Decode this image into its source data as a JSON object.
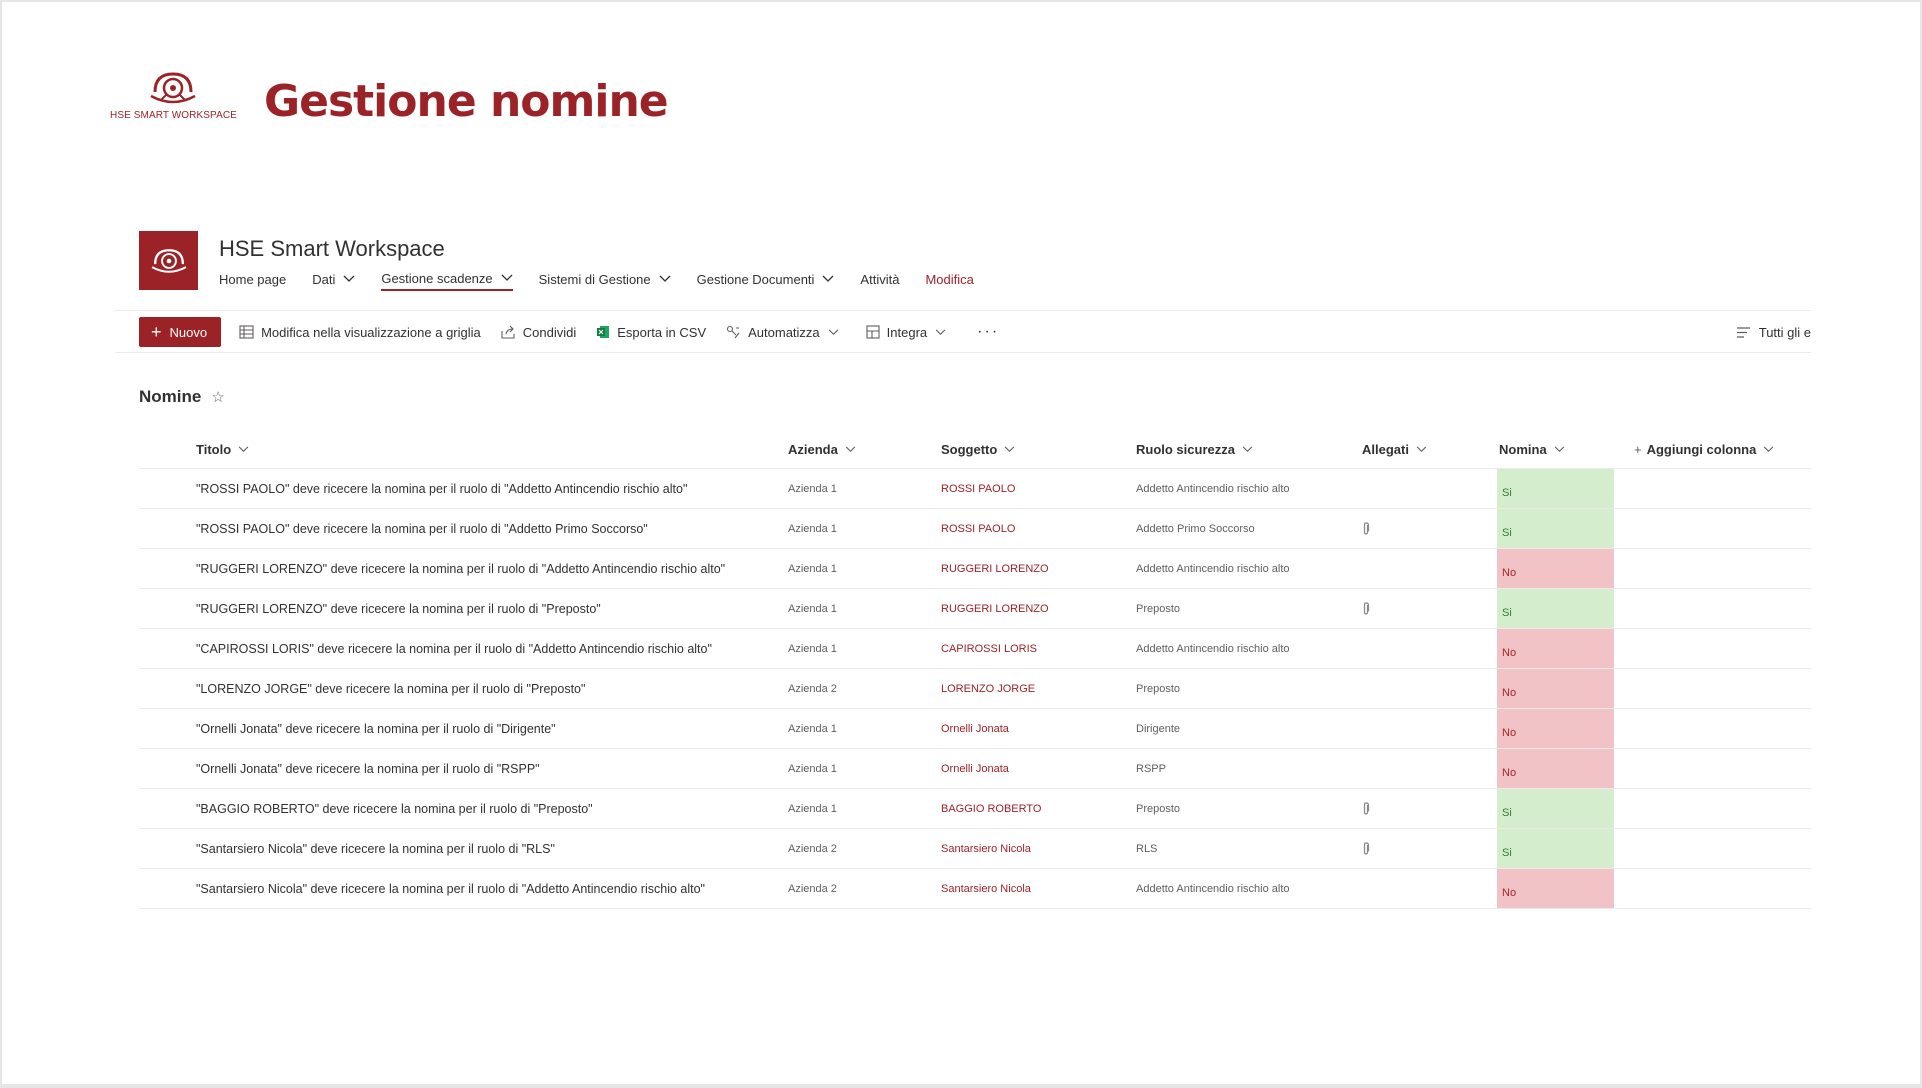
{
  "page": {
    "heading": "Gestione nomine",
    "brand_logo_text": "HSE SMART WORKSPACE"
  },
  "site": {
    "title": "HSE Smart Workspace",
    "nav": [
      {
        "label": "Home page"
      },
      {
        "label": "Dati"
      },
      {
        "label": "Gestione scadenze"
      },
      {
        "label": "Sistemi di Gestione"
      },
      {
        "label": "Gestione Documenti"
      },
      {
        "label": "Attività"
      },
      {
        "label": "Modifica"
      }
    ]
  },
  "command_bar": {
    "new_label": "Nuovo",
    "grid_edit_label": "Modifica nella visualizzazione a griglia",
    "share_label": "Condividi",
    "export_label": "Esporta in CSV",
    "automate_label": "Automatizza",
    "integrate_label": "Integra",
    "more_label": "···",
    "view_label": "Tutti gli e"
  },
  "list": {
    "title": "Nomine",
    "columns": {
      "titolo": "Titolo",
      "azienda": "Azienda",
      "soggetto": "Soggetto",
      "ruolo": "Ruolo sicurezza",
      "allegati": "Allegati",
      "nomina": "Nomina",
      "add": "Aggiungi colonna"
    },
    "rows": [
      {
        "titolo": "\"ROSSI PAOLO\" deve ricecere la nomina per il ruolo di \"Addetto Antincendio rischio alto\"",
        "azienda": "Azienda 1",
        "soggetto": "ROSSI PAOLO",
        "ruolo": "Addetto Antincendio rischio alto",
        "allegati": false,
        "nomina": "Si"
      },
      {
        "titolo": "\"ROSSI PAOLO\" deve ricecere la nomina per il ruolo di \"Addetto Primo Soccorso\"",
        "azienda": "Azienda 1",
        "soggetto": "ROSSI PAOLO",
        "ruolo": "Addetto Primo Soccorso",
        "allegati": true,
        "nomina": "Si"
      },
      {
        "titolo": "\"RUGGERI LORENZO\" deve ricecere la nomina per il ruolo di \"Addetto Antincendio rischio alto\"",
        "azienda": "Azienda 1",
        "soggetto": "RUGGERI LORENZO",
        "ruolo": "Addetto Antincendio rischio alto",
        "allegati": false,
        "nomina": "No"
      },
      {
        "titolo": "\"RUGGERI LORENZO\" deve ricecere la nomina per il ruolo di \"Preposto\"",
        "azienda": "Azienda 1",
        "soggetto": "RUGGERI LORENZO",
        "ruolo": "Preposto",
        "allegati": true,
        "nomina": "Si"
      },
      {
        "titolo": "\"CAPIROSSI LORIS\" deve ricecere la nomina per il ruolo di \"Addetto Antincendio rischio alto\"",
        "azienda": "Azienda 1",
        "soggetto": "CAPIROSSI LORIS",
        "ruolo": "Addetto Antincendio rischio alto",
        "allegati": false,
        "nomina": "No"
      },
      {
        "titolo": "\"LORENZO JORGE\" deve ricecere la nomina per il ruolo di \"Preposto\"",
        "azienda": "Azienda 2",
        "soggetto": "LORENZO JORGE",
        "ruolo": "Preposto",
        "allegati": false,
        "nomina": "No"
      },
      {
        "titolo": "\"Ornelli Jonata\" deve ricecere la nomina per il ruolo di \"Dirigente\"",
        "azienda": "Azienda 1",
        "soggetto": "Ornelli Jonata",
        "ruolo": "Dirigente",
        "allegati": false,
        "nomina": "No"
      },
      {
        "titolo": "\"Ornelli Jonata\" deve ricecere la nomina per il ruolo di \"RSPP\"",
        "azienda": "Azienda 1",
        "soggetto": "Ornelli Jonata",
        "ruolo": "RSPP",
        "allegati": false,
        "nomina": "No"
      },
      {
        "titolo": "\"BAGGIO ROBERTO\" deve ricecere la nomina per il ruolo di \"Preposto\"",
        "azienda": "Azienda 1",
        "soggetto": "BAGGIO ROBERTO",
        "ruolo": "Preposto",
        "allegati": true,
        "nomina": "Si"
      },
      {
        "titolo": "\"Santarsiero Nicola\" deve ricecere la nomina per il ruolo di \"RLS\"",
        "azienda": "Azienda 2",
        "soggetto": "Santarsiero Nicola",
        "ruolo": "RLS",
        "allegati": true,
        "nomina": "Si"
      },
      {
        "titolo": "\"Santarsiero Nicola\" deve ricecere la nomina per il ruolo di \"Addetto Antincendio rischio alto\"",
        "azienda": "Azienda 2",
        "soggetto": "Santarsiero Nicola",
        "ruolo": "Addetto Antincendio rischio alto",
        "allegati": false,
        "nomina": "No"
      }
    ]
  },
  "colors": {
    "brand": "#9b2226",
    "nomina_si_bg": "#d4edcd",
    "nomina_no_bg": "#f1c3c6"
  },
  "icons": [
    "hse-logo-icon",
    "grid-edit-icon",
    "share-icon",
    "excel-icon",
    "automate-icon",
    "integrate-icon",
    "view-list-icon",
    "star-icon",
    "paperclip-icon",
    "chevron-down-icon",
    "plus-icon"
  ]
}
